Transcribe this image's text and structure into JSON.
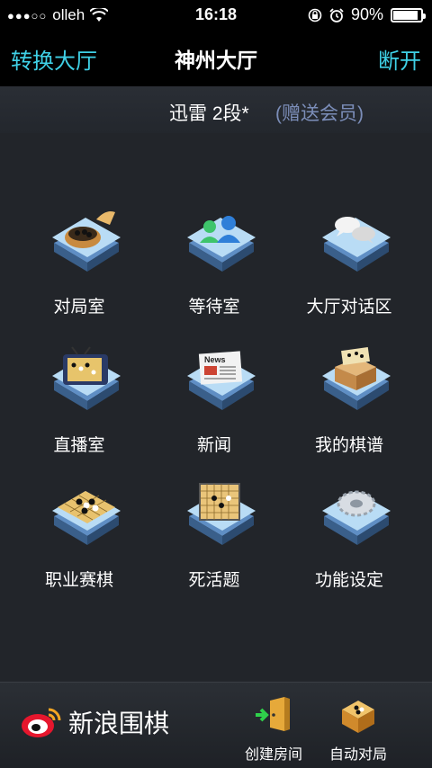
{
  "status": {
    "carrier": "olleh",
    "time": "16:18",
    "battery": "90%",
    "battery_level": 0.9
  },
  "nav": {
    "left": "转换大厅",
    "title": "神州大厅",
    "right": "断开"
  },
  "user": {
    "name": "迅雷 2段*",
    "member": "(赠送会员)"
  },
  "tiles": [
    {
      "label": "对局室"
    },
    {
      "label": "等待室"
    },
    {
      "label": "大厅对话区"
    },
    {
      "label": "直播室"
    },
    {
      "label": "新闻",
      "icon_text": "News"
    },
    {
      "label": "我的棋谱"
    },
    {
      "label": "职业赛棋"
    },
    {
      "label": "死活题"
    },
    {
      "label": "功能设定"
    }
  ],
  "bottom": {
    "brand": "新浪围棋",
    "create_room": "创建房间",
    "auto_match": "自动对局"
  },
  "colors": {
    "accent": "#3fd0e6",
    "member": "#7b8db8"
  }
}
